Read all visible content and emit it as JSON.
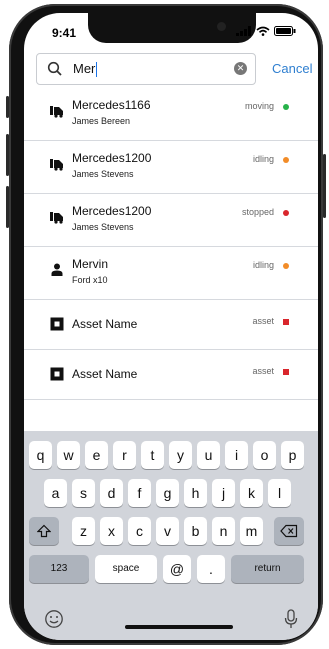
{
  "status_bar": {
    "time": "9:41"
  },
  "search": {
    "value": "Mer",
    "cancel_label": "Cancel"
  },
  "results": [
    {
      "title": "Mercedes1166",
      "subtitle": "James Bereen",
      "status": "moving",
      "kind": "vehicle",
      "status_color": "#27b24a"
    },
    {
      "title": "Mercedes1200",
      "subtitle": "James Stevens",
      "status": "idling",
      "kind": "vehicle",
      "status_color": "#f28c28"
    },
    {
      "title": "Mercedes1200",
      "subtitle": "James Stevens",
      "status": "stopped",
      "kind": "vehicle",
      "status_color": "#d9262c"
    },
    {
      "title": "Mervin",
      "subtitle": "Ford x10",
      "status": "idling",
      "kind": "person",
      "status_color": "#f28c28"
    },
    {
      "title": "Asset Name",
      "subtitle": "",
      "status": "asset",
      "kind": "asset",
      "status_color": "#d9262c"
    },
    {
      "title": "Asset Name",
      "subtitle": "",
      "status": "asset",
      "kind": "asset",
      "status_color": "#d9262c"
    }
  ],
  "keyboard": {
    "row1": [
      "q",
      "w",
      "e",
      "r",
      "t",
      "y",
      "u",
      "i",
      "o",
      "p"
    ],
    "row2": [
      "a",
      "s",
      "d",
      "f",
      "g",
      "h",
      "j",
      "k",
      "l"
    ],
    "row3": [
      "z",
      "x",
      "c",
      "v",
      "b",
      "n",
      "m"
    ],
    "numbers_label": "123",
    "space_label": "space",
    "at_label": "@",
    "dot_label": ".",
    "return_label": "return"
  },
  "icons": {
    "search": "search-icon",
    "clear": "clear-icon",
    "vehicle": "truck-icon",
    "person": "person-icon",
    "asset": "asset-square-icon",
    "shift": "shift-icon",
    "delete": "backspace-icon",
    "emoji": "emoji-icon",
    "mic": "microphone-icon"
  }
}
